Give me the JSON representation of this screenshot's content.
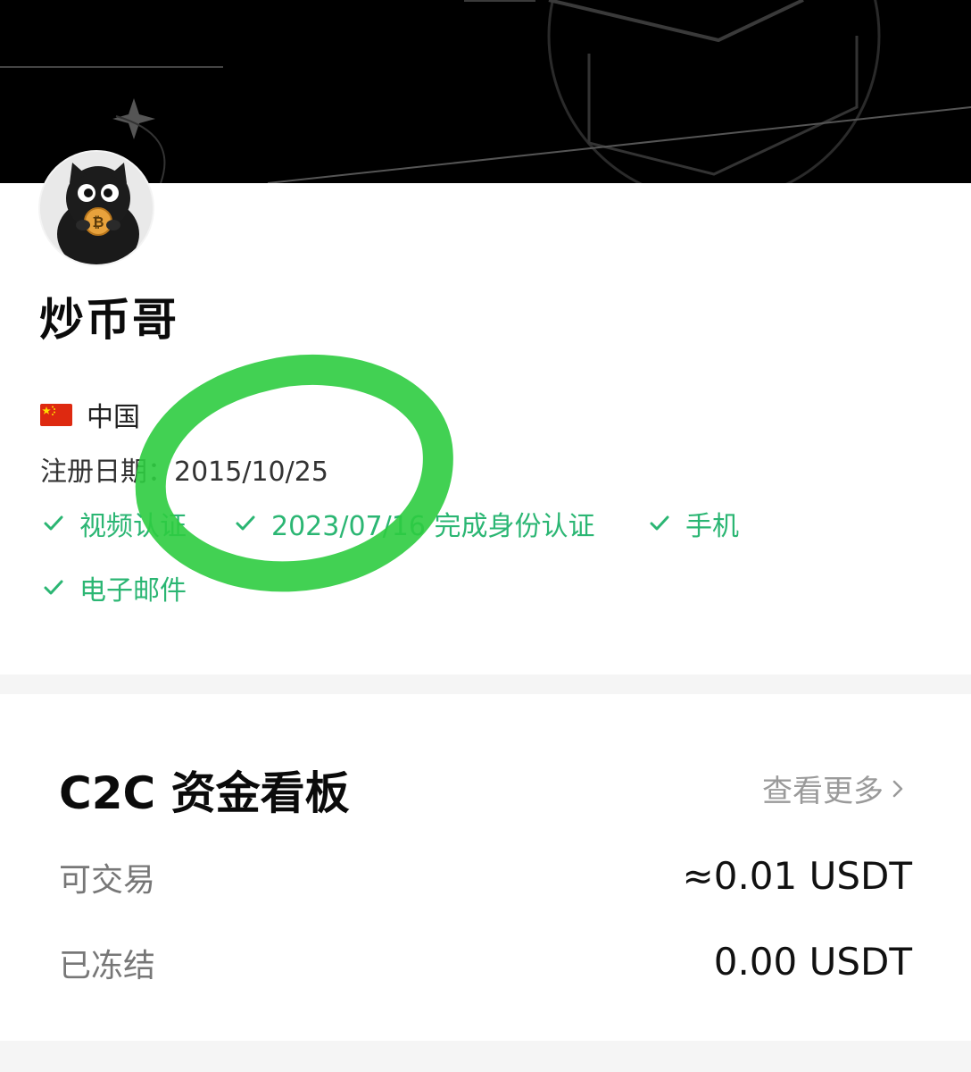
{
  "profile": {
    "nickname": "炒币哥",
    "country": "中国",
    "flag_icon": "china-flag-icon",
    "register_label": "注册日期：",
    "register_date": "2015/10/25"
  },
  "verifications": [
    {
      "label": "视频认证",
      "icon": "check-icon"
    },
    {
      "label": "2023/07/16 完成身份认证",
      "icon": "check-icon"
    },
    {
      "label": "手机",
      "icon": "check-icon"
    },
    {
      "label": "电子邮件",
      "icon": "check-icon"
    }
  ],
  "board": {
    "title": "C2C 资金看板",
    "more_label": "查看更多",
    "rows": [
      {
        "label": "可交易",
        "value": "≈0.01 USDT"
      },
      {
        "label": "已冻结",
        "value": "0.00 USDT"
      }
    ]
  },
  "colors": {
    "accent_green": "#2bb673",
    "highlight_green": "#2ecc40",
    "banner_bg": "#000000"
  }
}
